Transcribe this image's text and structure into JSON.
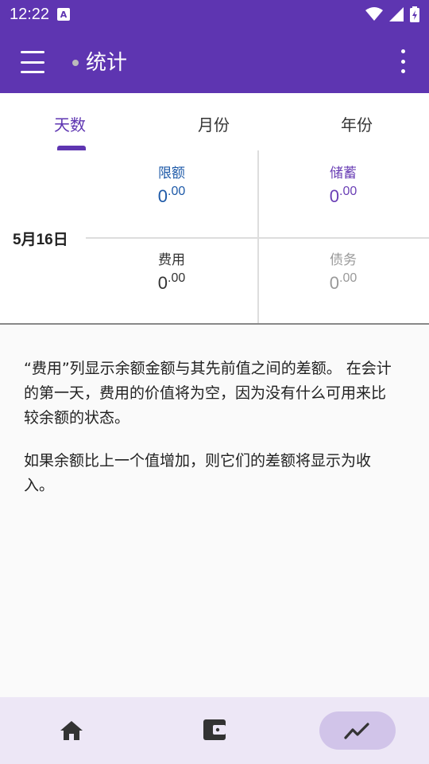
{
  "status_bar": {
    "time": "12:22",
    "notification_badge": "A"
  },
  "app_bar": {
    "title": "统计"
  },
  "tabs": [
    {
      "label": "天数",
      "selected": true
    },
    {
      "label": "月份",
      "selected": false
    },
    {
      "label": "年份",
      "selected": false
    }
  ],
  "stats": {
    "date": "5月16日",
    "limit": {
      "label": "限额",
      "int": "0",
      "dec": ".00"
    },
    "savings": {
      "label": "储蓄",
      "int": "0",
      "dec": ".00"
    },
    "expense": {
      "label": "费用",
      "int": "0",
      "dec": ".00"
    },
    "debt": {
      "label": "债务",
      "int": "0",
      "dec": ".00"
    }
  },
  "notes": {
    "p1": "“费用”列显示余额金额与其先前值之间的差额。 在会计的第一天，费用的价值将为空，因为没有什么可用来比较余额的状态。",
    "p2": "如果余额比上一个值增加，则它们的差额将显示为收入。"
  },
  "colors": {
    "primary": "#5e35b1",
    "limit": "#1e5aa8",
    "savings": "#6a3fb5",
    "expense": "#333333",
    "debt": "#999999"
  },
  "bottom_nav": {
    "selected": "stats-icon"
  }
}
